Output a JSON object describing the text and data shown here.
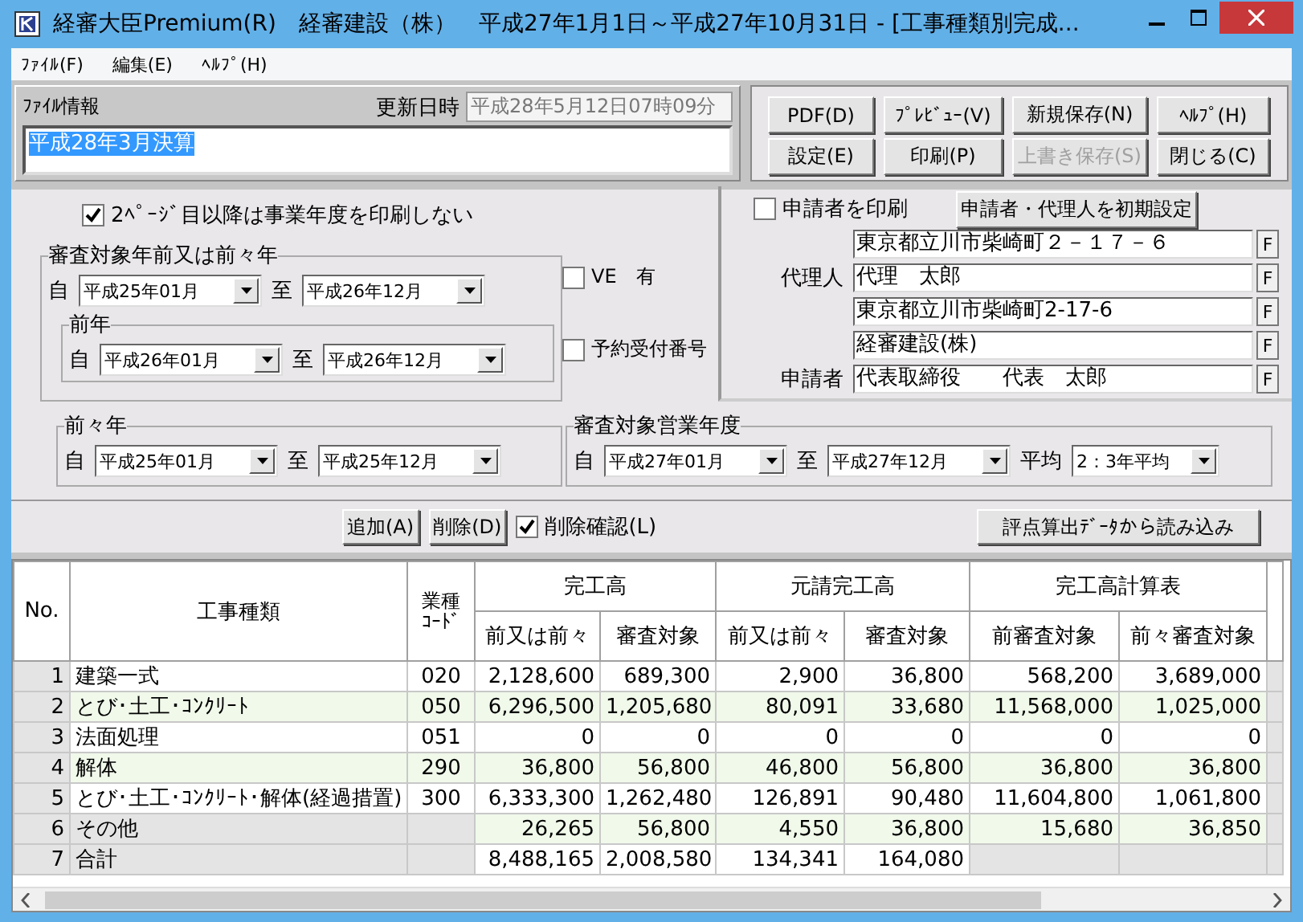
{
  "window": {
    "title": "経審大臣Premium(R)　経審建設（株）　平成27年1月1日～平成27年10月31日 - [工事種類別完成..."
  },
  "menu": [
    "ﾌｧｲﾙ(F)",
    "編集(E)",
    "ﾍﾙﾌﾟ(H)"
  ],
  "file_info": {
    "label": "ﾌｧｲﾙ情報",
    "updated_label": "更新日時",
    "updated_value": "平成28年5月12日07時09分",
    "memo": "平成28年3月決算",
    "memo_selected": true
  },
  "actions": [
    {
      "label": "PDF(D)",
      "disabled": false
    },
    {
      "label": "ﾌﾟﾚﾋﾞｭｰ(V)",
      "disabled": false
    },
    {
      "label": "新規保存(N)",
      "disabled": false
    },
    {
      "label": "ﾍﾙﾌﾟ(H)",
      "disabled": false
    },
    {
      "label": "設定(E)",
      "disabled": false
    },
    {
      "label": "印刷(P)",
      "disabled": false
    },
    {
      "label": "上書き保存(S)",
      "disabled": true
    },
    {
      "label": "閉じる(C)",
      "disabled": false
    }
  ],
  "print_option": {
    "label": "2ﾍﾟｰｼﾞ目以降は事業年度を印刷しない",
    "checked": true
  },
  "period_group": {
    "title": "審査対象年前又は前々年",
    "from_label": "自",
    "from": "平成25年01月",
    "to_label": "至",
    "to": "平成26年12月"
  },
  "prev_year": {
    "title": "前年",
    "from_label": "自",
    "from": "平成26年01月",
    "to_label": "至",
    "to": "平成26年12月"
  },
  "prev2_year": {
    "title": "前々年",
    "from_label": "自",
    "from": "平成25年01月",
    "to_label": "至",
    "to": "平成25年12月"
  },
  "ve": {
    "label": "VE　有",
    "checked": false
  },
  "reservation": {
    "label": "予約受付番号",
    "checked": false
  },
  "applicant": {
    "print": {
      "label": "申請者を印刷",
      "checked": false
    },
    "reset_button": "申請者・代理人を初期設定",
    "fields": [
      {
        "value": "東京都立川市柴崎町２－１７－６",
        "button": "F"
      },
      {
        "label": "代理人",
        "value": "代理　太郎",
        "button": "F"
      },
      {
        "value": "東京都立川市柴崎町2-17-6",
        "button": "F"
      },
      {
        "value": "経審建設(株)",
        "button": "F"
      },
      {
        "label": "申請者",
        "value": "代表取締役　　代表　太郎",
        "button": "F"
      }
    ]
  },
  "business_year": {
    "title": "審査対象営業年度",
    "from_label": "自",
    "from": "平成27年01月",
    "to_label": "至",
    "to": "平成27年12月",
    "avg_label": "平均",
    "avg": "2：3年平均"
  },
  "toolbar": {
    "add": "追加(A)",
    "delete": "削除(D)",
    "confirm": {
      "label": "削除確認(L)",
      "checked": true
    },
    "import": "評点算出ﾃﾞｰﾀから読み込み"
  },
  "table": {
    "columns": [
      {
        "label": "No."
      },
      {
        "label": "工事種類"
      },
      {
        "label": "業種ｺｰﾄﾞ"
      },
      {
        "label": "完工高",
        "children": [
          "前又は前々",
          "審査対象"
        ]
      },
      {
        "label": "元請完工高",
        "children": [
          "前又は前々",
          "審査対象"
        ]
      },
      {
        "label": "完工高計算表",
        "children": [
          "前審査対象",
          "前々審査対象"
        ]
      }
    ],
    "rows": [
      {
        "no": "1",
        "type": "建築一式",
        "code": "020",
        "values": [
          "2,128,600",
          "689,300",
          "2,900",
          "36,800",
          "568,200",
          "3,689,000"
        ],
        "kind": "item"
      },
      {
        "no": "2",
        "type": "とび･土工･ｺﾝｸﾘｰﾄ",
        "code": "050",
        "values": [
          "6,296,500",
          "1,205,680",
          "80,091",
          "33,680",
          "11,568,000",
          "1,025,000"
        ],
        "kind": "item"
      },
      {
        "no": "3",
        "type": "法面処理",
        "code": "051",
        "values": [
          "0",
          "0",
          "0",
          "0",
          "0",
          "0"
        ],
        "kind": "item"
      },
      {
        "no": "4",
        "type": "解体",
        "code": "290",
        "values": [
          "36,800",
          "56,800",
          "46,800",
          "56,800",
          "36,800",
          "36,800"
        ],
        "kind": "item"
      },
      {
        "no": "5",
        "type": "とび･土工･ｺﾝｸﾘｰﾄ･解体(経過措置)",
        "code": "300",
        "values": [
          "6,333,300",
          "1,262,480",
          "126,891",
          "90,480",
          "11,604,800",
          "1,061,800"
        ],
        "kind": "item"
      },
      {
        "no": "6",
        "type": "その他",
        "values": [
          "26,265",
          "56,800",
          "4,550",
          "36,800",
          "15,680",
          "36,850"
        ],
        "kind": "other"
      },
      {
        "no": "7",
        "type": "合計",
        "values": [
          "8,488,165",
          "2,008,580",
          "134,341",
          "164,080"
        ],
        "kind": "total"
      }
    ]
  }
}
